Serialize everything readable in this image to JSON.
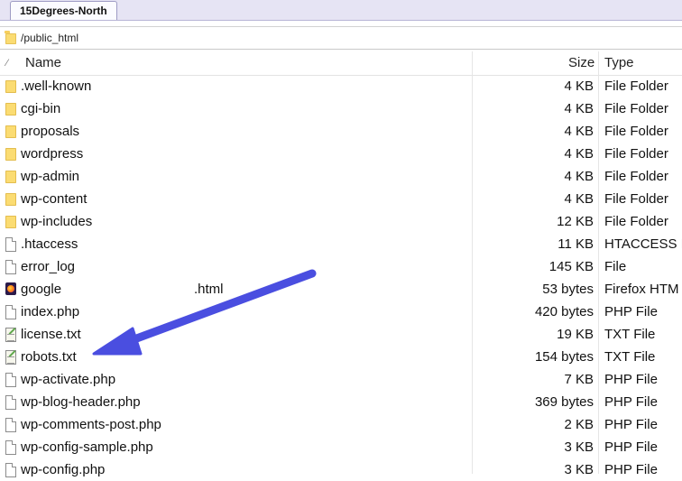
{
  "tab": {
    "label": "15Degrees-North"
  },
  "path": {
    "text": "/public_html"
  },
  "columns": {
    "sort_glyph": "⁄",
    "name": "Name",
    "size": "Size",
    "type": "Type"
  },
  "files": [
    {
      "name": ".well-known",
      "size": "4 KB",
      "type": "File Folder",
      "icon": "folder-icon"
    },
    {
      "name": "cgi-bin",
      "size": "4 KB",
      "type": "File Folder",
      "icon": "folder-icon"
    },
    {
      "name": "proposals",
      "size": "4 KB",
      "type": "File Folder",
      "icon": "folder-icon"
    },
    {
      "name": "wordpress",
      "size": "4 KB",
      "type": "File Folder",
      "icon": "folder-icon"
    },
    {
      "name": "wp-admin",
      "size": "4 KB",
      "type": "File Folder",
      "icon": "folder-icon"
    },
    {
      "name": "wp-content",
      "size": "4 KB",
      "type": "File Folder",
      "icon": "folder-icon"
    },
    {
      "name": "wp-includes",
      "size": "12 KB",
      "type": "File Folder",
      "icon": "folder-icon"
    },
    {
      "name": ".htaccess",
      "size": "11 KB",
      "type": "HTACCESS F",
      "icon": "file-icon"
    },
    {
      "name": "error_log",
      "size": "145 KB",
      "type": "File",
      "icon": "file-icon"
    },
    {
      "name": "google",
      "name_suffix": ".html",
      "size": "53 bytes",
      "type": "Firefox HTM",
      "icon": "firefox-file-icon"
    },
    {
      "name": "index.php",
      "size": "420 bytes",
      "type": "PHP File",
      "icon": "file-icon"
    },
    {
      "name": "license.txt",
      "size": "19 KB",
      "type": "TXT File",
      "icon": "text-file-icon"
    },
    {
      "name": "robots.txt",
      "size": "154 bytes",
      "type": "TXT File",
      "icon": "text-file-icon"
    },
    {
      "name": "wp-activate.php",
      "size": "7 KB",
      "type": "PHP File",
      "icon": "file-icon"
    },
    {
      "name": "wp-blog-header.php",
      "size": "369 bytes",
      "type": "PHP File",
      "icon": "file-icon"
    },
    {
      "name": "wp-comments-post.php",
      "size": "2 KB",
      "type": "PHP File",
      "icon": "file-icon"
    },
    {
      "name": "wp-config-sample.php",
      "size": "3 KB",
      "type": "PHP File",
      "icon": "file-icon"
    },
    {
      "name": "wp-config.php",
      "size": "3 KB",
      "type": "PHP File",
      "icon": "file-icon"
    }
  ],
  "colors": {
    "annotation_arrow": "#4a4ee0",
    "tab_bg": "#e6e4f4",
    "folder": "#fbdc72"
  }
}
